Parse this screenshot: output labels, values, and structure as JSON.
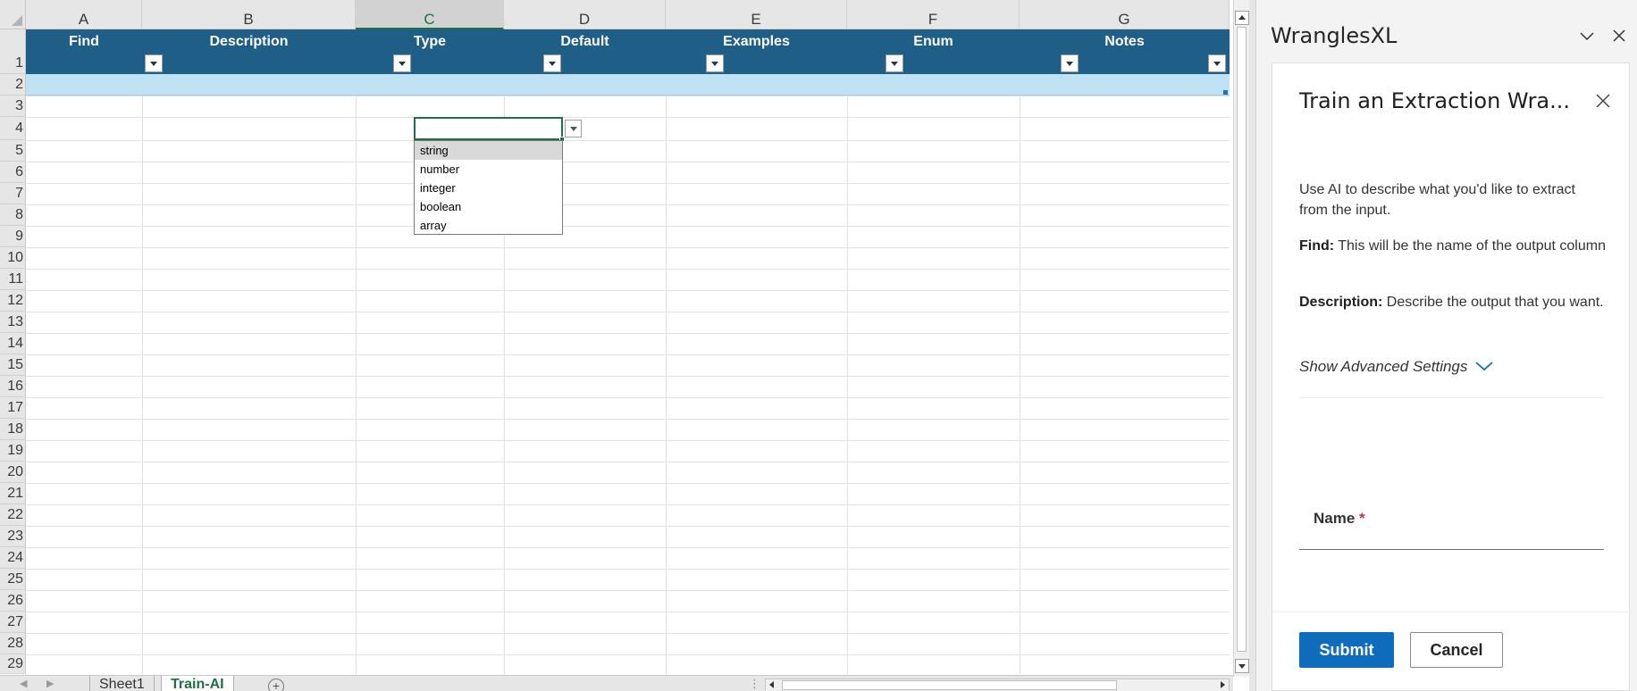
{
  "sheet": {
    "columns": [
      "A",
      "B",
      "C",
      "D",
      "E",
      "F",
      "G"
    ],
    "active_column": "C",
    "rows": [
      "1",
      "2",
      "3",
      "4",
      "5",
      "6",
      "7",
      "8",
      "9",
      "10",
      "11",
      "12",
      "13",
      "14",
      "15",
      "16",
      "17",
      "18",
      "19",
      "20",
      "21",
      "22",
      "23",
      "24",
      "25",
      "26",
      "27",
      "28",
      "29"
    ],
    "table_headers": [
      "Find",
      "Description",
      "Type",
      "Default",
      "Examples",
      "Enum",
      "Notes"
    ],
    "active_cell": "C4",
    "dropdown_options": [
      "string",
      "number",
      "integer",
      "boolean",
      "array"
    ],
    "dropdown_highlighted": "string",
    "tabs": [
      "Sheet1",
      "Train-AI"
    ],
    "active_tab": "Train-AI",
    "colors": {
      "table_header": "#1f5f87",
      "row_band": "#bfe3f4",
      "active_green": "#1e7145"
    }
  },
  "pane": {
    "title": "WranglesXL",
    "card": {
      "title": "Train an Extraction Wra...",
      "intro": "Use AI to describe what you'd like to extract from the input.",
      "find_label": "Find:",
      "find_text": "This will be the name of the output column",
      "description_label": "Description:",
      "description_text": "Describe the output that you want.",
      "advanced_label": "Show Advanced Settings",
      "name_label": "Name",
      "name_required": "*",
      "name_value": "",
      "submit_label": "Submit",
      "cancel_label": "Cancel"
    },
    "colors": {
      "primary_button": "#0f6cbd",
      "required_star": "#c4314b"
    }
  },
  "icons": {
    "pane_collapse": "chevron-down-icon",
    "pane_close": "close-icon",
    "card_close": "close-icon",
    "advanced_toggle": "chevron-down-icon",
    "filter": "filter-dropdown-icon",
    "add_sheet": "plus-circle-icon"
  }
}
